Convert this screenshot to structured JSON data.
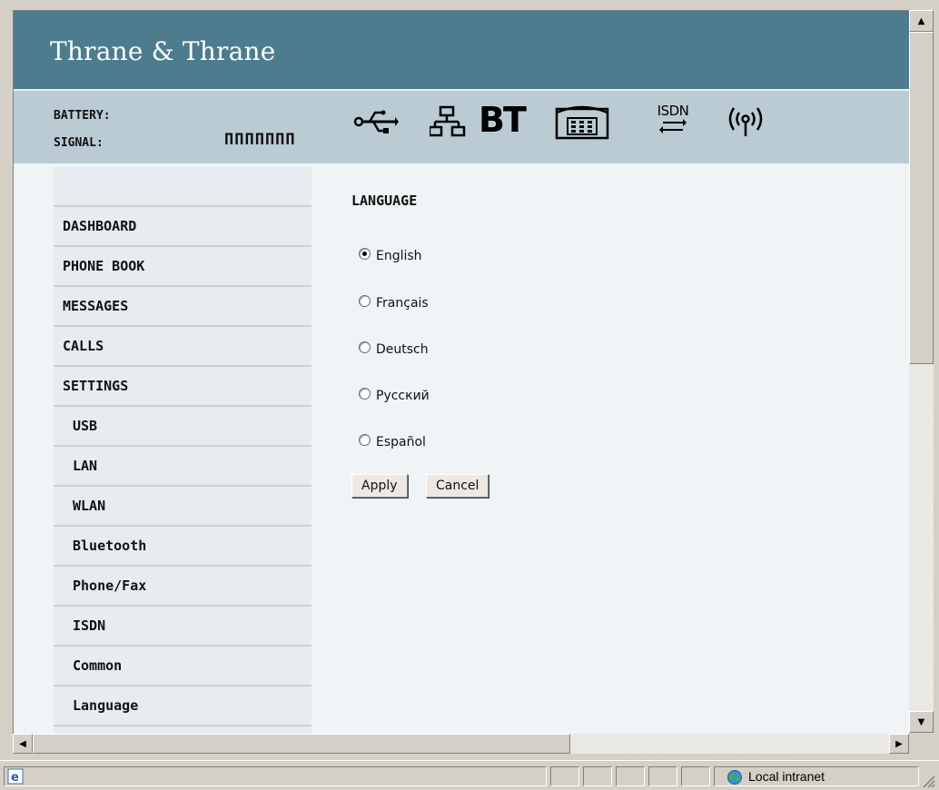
{
  "brand": {
    "title": "Thrane & Thrane"
  },
  "status": {
    "battery_label": "BATTERY:",
    "signal_label": "SIGNAL:",
    "signal_value": "ΠΠΠΠΠΠΠ"
  },
  "status_icons": [
    "usb-icon",
    "lan-icon",
    "bluetooth-icon",
    "phone-icon",
    "isdn-icon",
    "wlan-icon"
  ],
  "icon_labels": {
    "bt": "BT",
    "isdn": "ISDN"
  },
  "sidebar": {
    "items": [
      {
        "label": "DASHBOARD",
        "sub": false
      },
      {
        "label": "PHONE BOOK",
        "sub": false
      },
      {
        "label": "MESSAGES",
        "sub": false
      },
      {
        "label": "CALLS",
        "sub": false
      },
      {
        "label": "SETTINGS",
        "sub": false
      },
      {
        "label": "USB",
        "sub": true
      },
      {
        "label": "LAN",
        "sub": true
      },
      {
        "label": "WLAN",
        "sub": true
      },
      {
        "label": "Bluetooth",
        "sub": true
      },
      {
        "label": "Phone/Fax",
        "sub": true
      },
      {
        "label": "ISDN",
        "sub": true
      },
      {
        "label": "Common",
        "sub": true
      },
      {
        "label": "Language",
        "sub": true
      }
    ]
  },
  "language": {
    "title": "LANGUAGE",
    "options": [
      {
        "label": "English",
        "checked": true
      },
      {
        "label": "Français",
        "checked": false
      },
      {
        "label": "Deutsch",
        "checked": false
      },
      {
        "label": "Русский",
        "checked": false
      },
      {
        "label": "Español",
        "checked": false
      }
    ],
    "apply_label": "Apply",
    "cancel_label": "Cancel"
  },
  "browser_status": {
    "zone": "Local intranet"
  },
  "colors": {
    "header": "#4e7c8f",
    "status_band": "#bacbd3",
    "sidebar": "#e6ecef",
    "page": "#f0f4f6"
  }
}
